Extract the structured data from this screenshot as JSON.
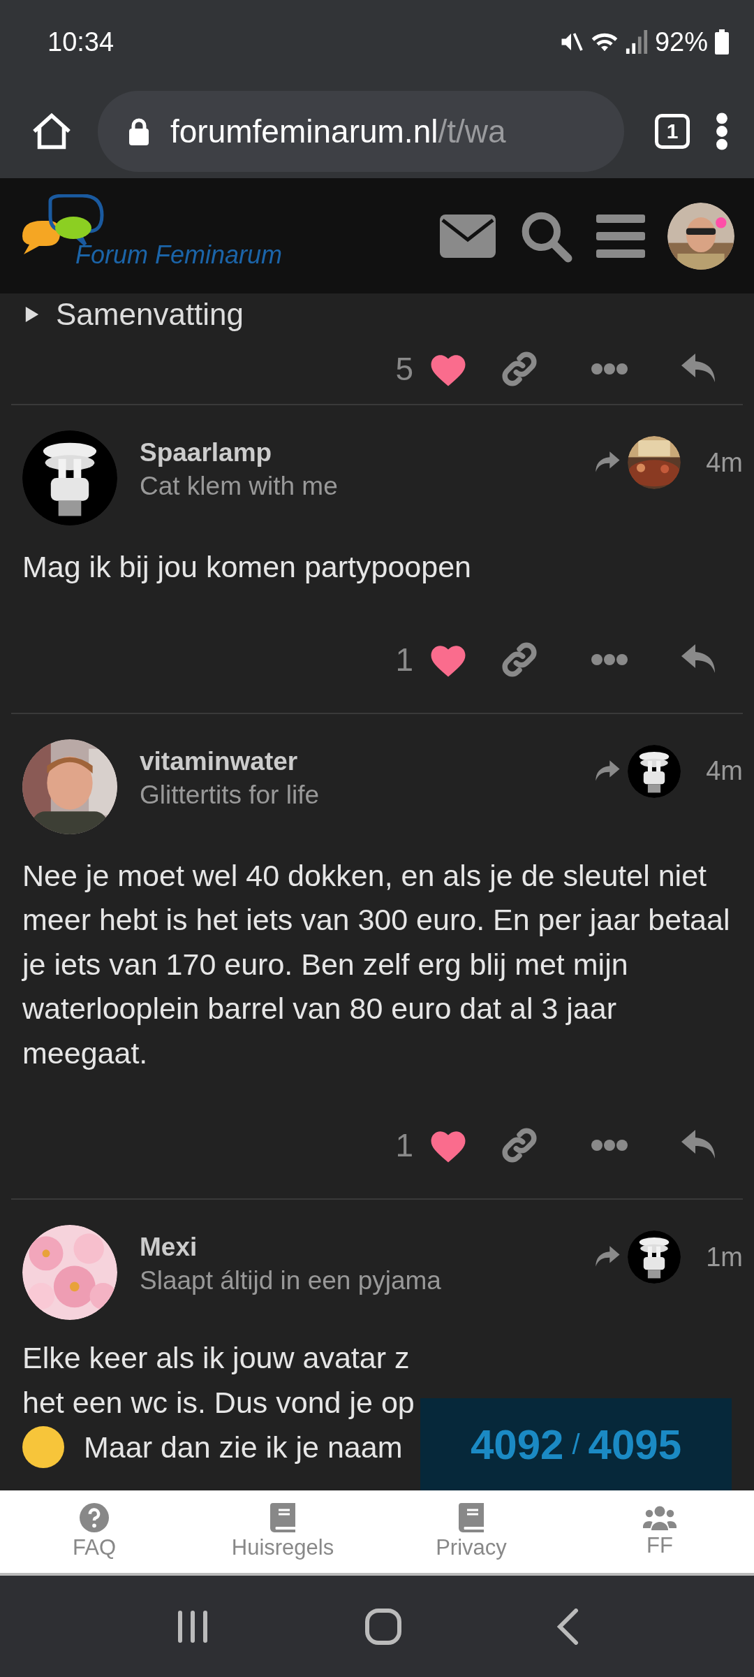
{
  "status_bar": {
    "time": "10:34",
    "battery": "92%"
  },
  "browser": {
    "url_host": "forumfeminarum.nl",
    "url_path": "/t/wa",
    "tab_count": "1"
  },
  "site_header": {
    "title": "Forum Feminarum"
  },
  "collapsed_section": {
    "label": "Samenvatting"
  },
  "previous_post_actions": {
    "like_count": "5"
  },
  "posts": [
    {
      "username": "Spaarlamp",
      "tagline": "Cat klem with me",
      "time": "4m",
      "body": "Mag ik bij jou komen partypoopen",
      "like_count": "1"
    },
    {
      "username": "vitaminwater",
      "tagline": "Glittertits for life",
      "time": "4m",
      "body": "Nee je moet wel 40 dokken, en als je de sleutel niet meer hebt is het iets van 300 euro. En per jaar betaal je iets van 170 euro. Ben zelf erg blij met mijn waterlooplein barrel van 80 euro dat al 3 jaar meegaat.",
      "like_count": "1"
    },
    {
      "username": "Mexi",
      "tagline": "Slaapt áltijd in een pyjama",
      "time": "1m",
      "body_lines": [
        "Elke keer als ik jouw avatar z",
        "het een wc is. Dus vond je op",
        "Maar dan zie ik je naam"
      ]
    }
  ],
  "progress": {
    "current": "4092",
    "separator": "/",
    "total": "4095"
  },
  "footer_nav": [
    {
      "label": "FAQ",
      "kind": "question"
    },
    {
      "label": "Huisregels",
      "kind": "book"
    },
    {
      "label": "Privacy",
      "kind": "book"
    },
    {
      "label": "FF",
      "kind": "group"
    }
  ]
}
